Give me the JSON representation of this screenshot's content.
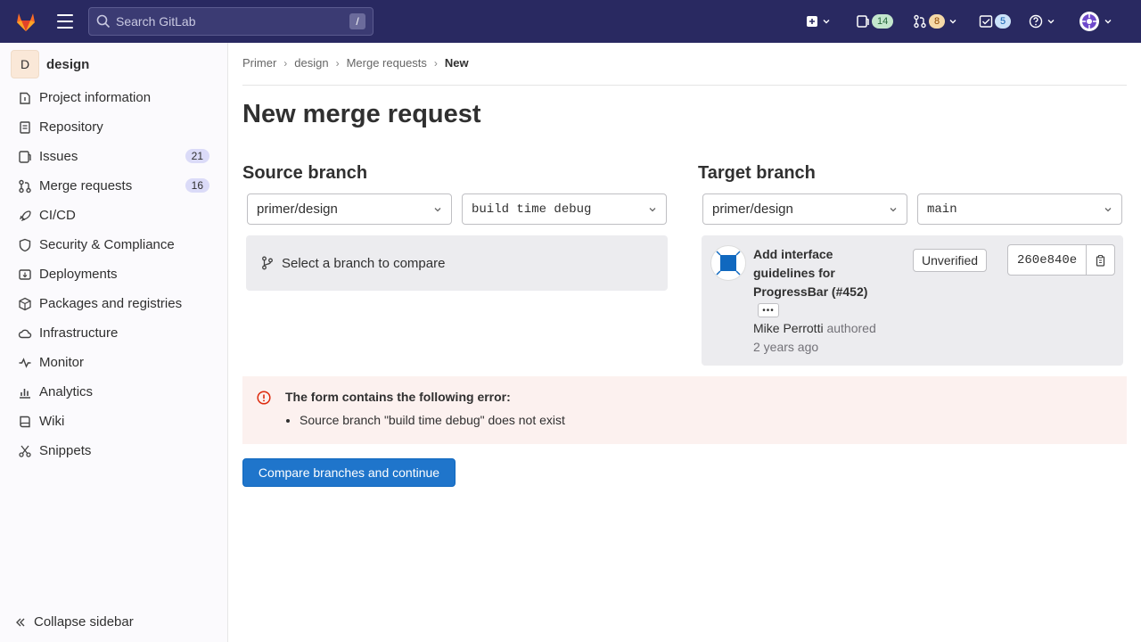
{
  "topbar": {
    "search_placeholder": "Search GitLab",
    "search_shortcut": "/",
    "issues_count": "14",
    "mr_count": "8",
    "todos_count": "5"
  },
  "sidebar": {
    "project_initial": "D",
    "project_name": "design",
    "items": [
      {
        "label": "Project information",
        "icon": "info-icon"
      },
      {
        "label": "Repository",
        "icon": "doc-icon"
      },
      {
        "label": "Issues",
        "icon": "issues-icon",
        "count": "21"
      },
      {
        "label": "Merge requests",
        "icon": "merge-icon",
        "count": "16"
      },
      {
        "label": "CI/CD",
        "icon": "rocket-icon"
      },
      {
        "label": "Security & Compliance",
        "icon": "shield-icon"
      },
      {
        "label": "Deployments",
        "icon": "deploy-icon"
      },
      {
        "label": "Packages and registries",
        "icon": "package-icon"
      },
      {
        "label": "Infrastructure",
        "icon": "cloud-icon"
      },
      {
        "label": "Monitor",
        "icon": "monitor-icon"
      },
      {
        "label": "Analytics",
        "icon": "chart-icon"
      },
      {
        "label": "Wiki",
        "icon": "book-icon"
      },
      {
        "label": "Snippets",
        "icon": "scissors-icon"
      }
    ],
    "collapse_label": "Collapse sidebar"
  },
  "breadcrumb": [
    "Primer",
    "design",
    "Merge requests",
    "New"
  ],
  "page_title": "New merge request",
  "source": {
    "title": "Source branch",
    "project": "primer/design",
    "branch": "build time debug",
    "compare_hint": "Select a branch to compare"
  },
  "target": {
    "title": "Target branch",
    "project": "primer/design",
    "branch": "main"
  },
  "commit": {
    "title": "Add interface guidelines for ProgressBar (#452)",
    "more": "•••",
    "author": "Mike Perrotti",
    "authored": "authored",
    "time": "2 years ago",
    "status": "Unverified",
    "sha": "260e840e"
  },
  "alert": {
    "title": "The form contains the following error:",
    "errors": [
      "Source branch \"build time debug\" does not exist"
    ]
  },
  "submit_label": "Compare branches and continue",
  "colors": {
    "topbar": "#292961",
    "primary": "#1f75cb",
    "alert_bg": "#fcf1ef",
    "danger": "#dd2b0e"
  }
}
